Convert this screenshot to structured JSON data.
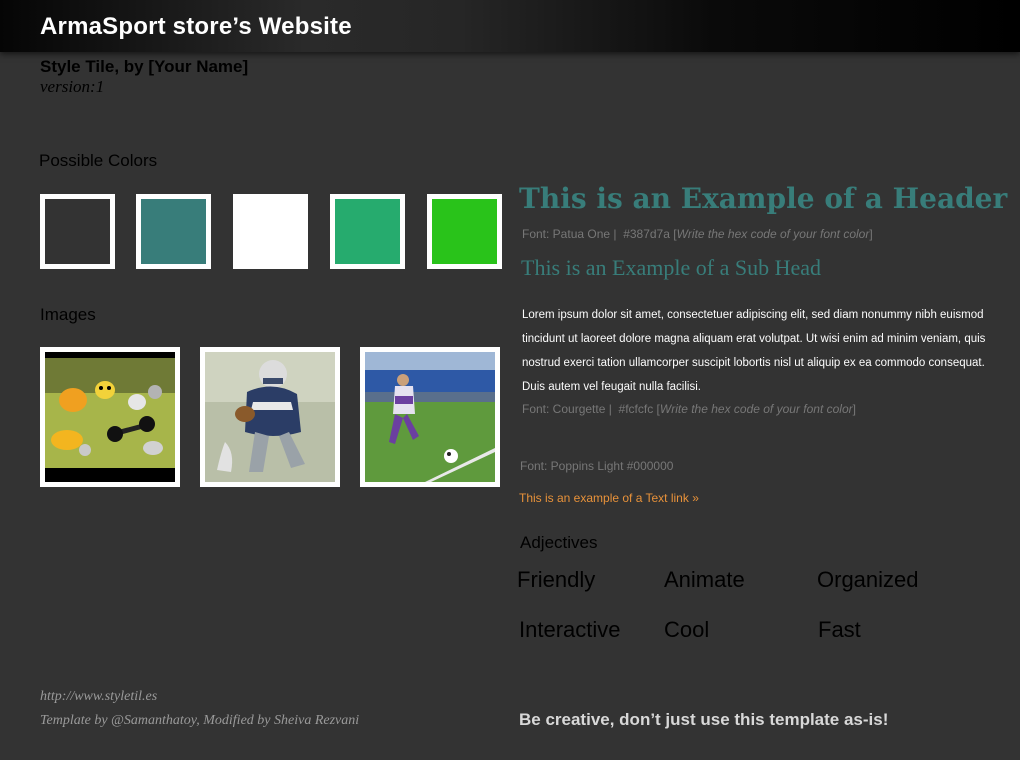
{
  "header": {
    "site_title": "ArmaSport store’s Website"
  },
  "tile": {
    "title": "Style Tile, by [Your Name]",
    "version": "version:1"
  },
  "colors": {
    "label": "Possible Colors",
    "swatches": [
      "#333333",
      "#387d7a",
      "#ffffff",
      "#26ab6e",
      "#29c31a"
    ]
  },
  "images": {
    "label": "Images",
    "items": [
      "sports-equipment-image",
      "football-player-image",
      "soccer-kid-image"
    ]
  },
  "typography": {
    "header_example": "This is an Example of a Header",
    "header_meta_font": "Font: Patua One",
    "header_meta_hex": "#387d7a",
    "header_meta_note": "Write the hex code of your font color",
    "subhead_example": "This is an Example of a Sub Head",
    "body_example": "Lorem ipsum dolor sit amet, consectetuer adipiscing elit, sed diam nonummy nibh euismod tincidunt ut laoreet dolore magna aliquam erat volutpat. Ut wisi enim ad minim veniam, quis nostrud exerci tation ullamcorper suscipit lobortis nisl ut aliquip ex ea commodo consequat. Duis autem vel feugait nulla facilisi.",
    "body_meta_font": "Font: Courgette",
    "body_meta_hex": "#fcfcfc",
    "body_meta_note": "Write the hex code of your font color",
    "poppins_meta": "Font: Poppins Light #000000",
    "text_link": "This is an example of a Text link »",
    "link_color": "#e8923a"
  },
  "adjectives": {
    "label": "Adjectives",
    "items": [
      "Friendly",
      "Animate",
      "Organized",
      "Interactive",
      "Cool",
      "Fast"
    ]
  },
  "footer": {
    "url": "http://www.styletil.es",
    "credit": "Template by @Samanthatoy, Modified by Sheiva Rezvani",
    "tagline": "Be creative, don’t just use this template as-is!"
  }
}
